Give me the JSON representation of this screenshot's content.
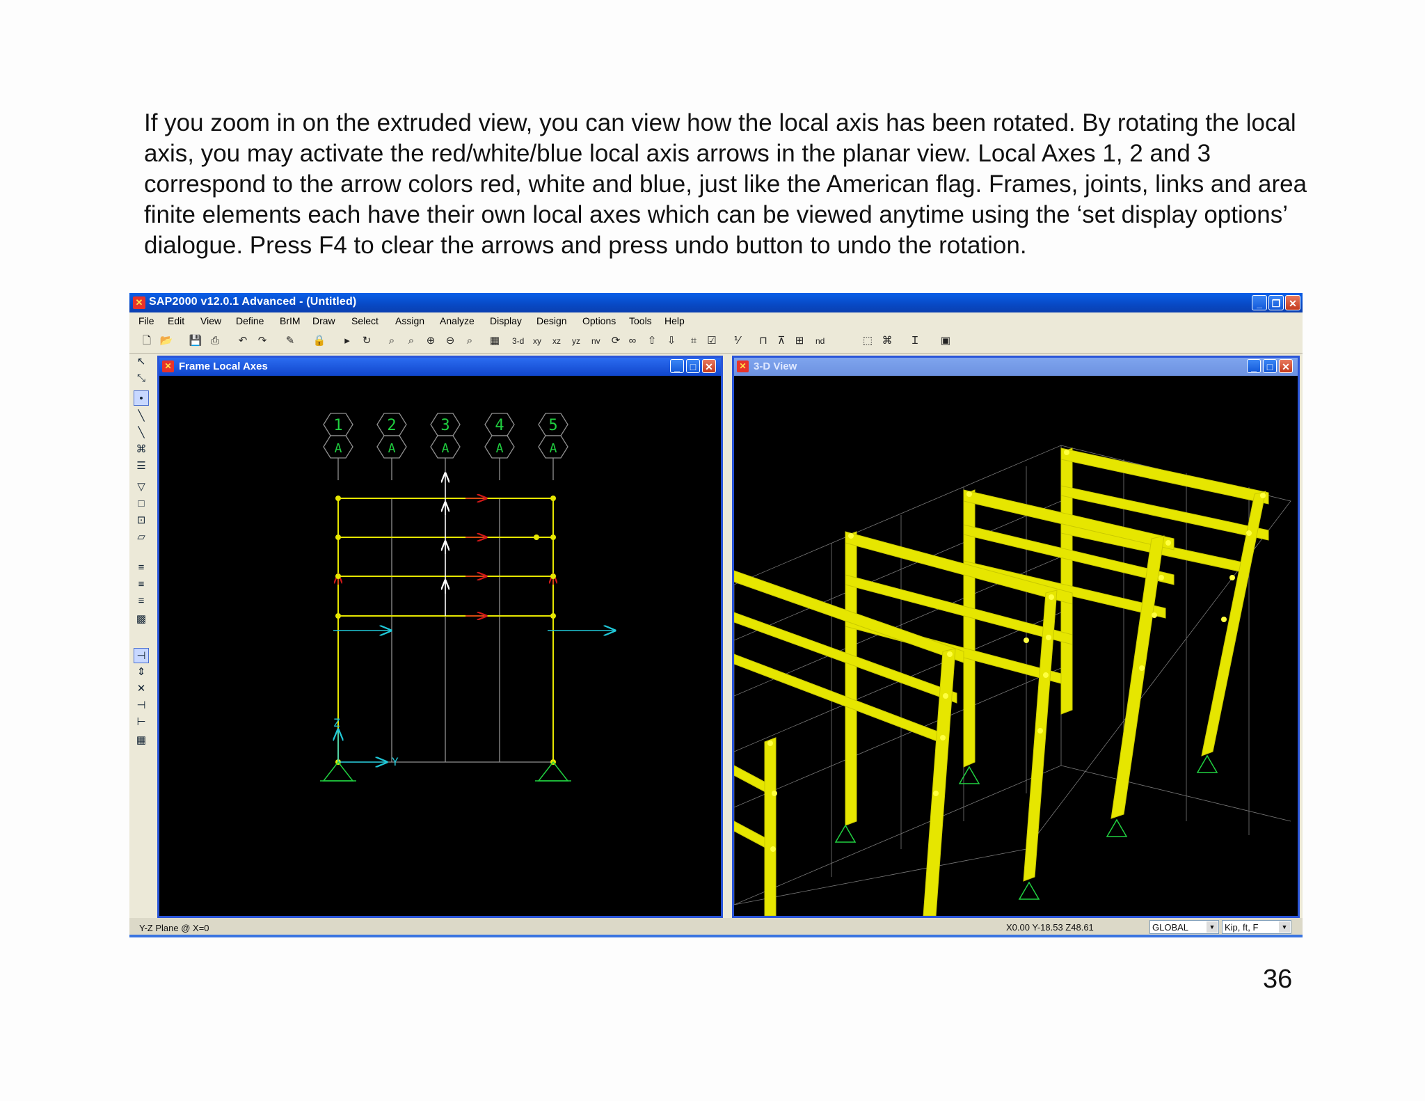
{
  "slide": {
    "paragraph": "If you zoom in on the extruded view, you can view how the local axis has been rotated. By rotating the local axis, you may activate the red/white/blue local axis arrows in the planar view. Local Axes 1, 2 and 3 correspond to the arrow colors red, white and blue, just like the American flag. Frames, joints, links and area finite elements each have their own local axes which can be viewed anytime using the ‘set display options’ dialogue. Press F4 to clear the arrows and press undo button to undo the rotation.",
    "page_number": "36"
  },
  "app": {
    "title": "SAP2000 v12.0.1 Advanced  - (Untitled)",
    "icon": "sap-logo-icon",
    "menu": [
      "File",
      "Edit",
      "View",
      "Define",
      "BrIM",
      "Draw",
      "Select",
      "Assign",
      "Analyze",
      "Display",
      "Design",
      "Options",
      "Tools",
      "Help"
    ],
    "toolbar_text": {
      "view_3d": "3-d",
      "xy": "xy",
      "xz": "xz",
      "yz": "yz",
      "nv": "nv",
      "nd": "nd"
    }
  },
  "left_window": {
    "title": "Frame Local Axes",
    "grid_numbers": [
      "1",
      "2",
      "3",
      "4",
      "5"
    ],
    "grid_letters": [
      "A",
      "A",
      "A",
      "A",
      "A"
    ],
    "axis_labels": {
      "z": "Z",
      "y": "Y"
    }
  },
  "right_window": {
    "title": "3-D View"
  },
  "status": {
    "plane": "Y-Z Plane @ X=0",
    "coords": "X0.00  Y-18.53  Z48.61",
    "coord_system": "GLOBAL",
    "units": "Kip, ft, F"
  },
  "colors": {
    "frame": "#e6e600",
    "local1": "#d01818",
    "local2": "#ffffff",
    "local3": "#20c8d8",
    "grid": "#909090",
    "bubble_text": "#20d040"
  }
}
